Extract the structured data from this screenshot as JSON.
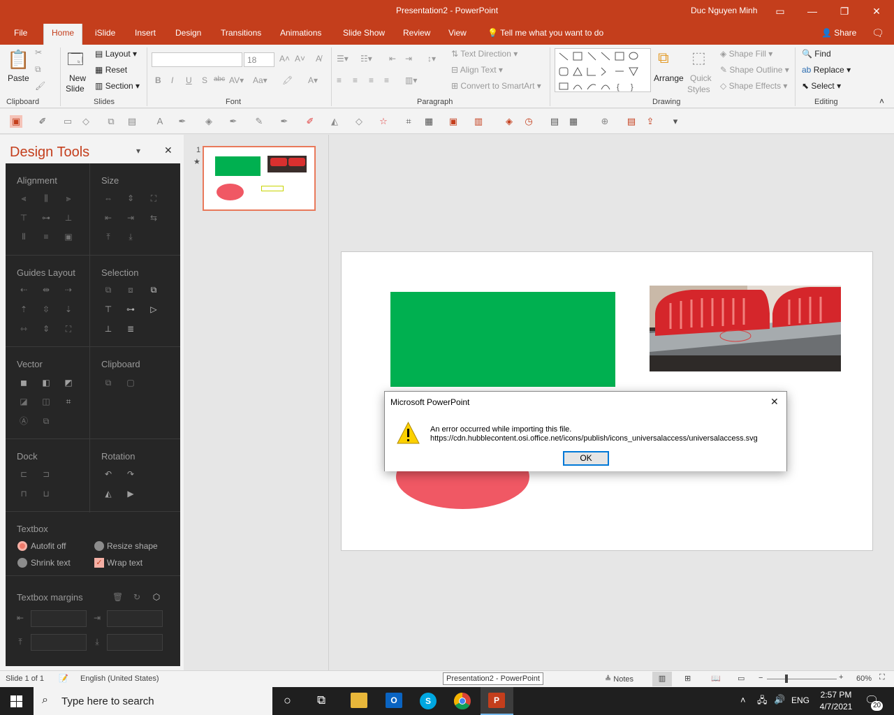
{
  "window": {
    "title": "Presentation2 - PowerPoint",
    "user": "Duc Nguyen Minh"
  },
  "tabs": [
    {
      "label": "File"
    },
    {
      "label": "Home"
    },
    {
      "label": "iSlide"
    },
    {
      "label": "Insert"
    },
    {
      "label": "Design"
    },
    {
      "label": "Transitions"
    },
    {
      "label": "Animations"
    },
    {
      "label": "Slide Show"
    },
    {
      "label": "Review"
    },
    {
      "label": "View"
    }
  ],
  "tell_me": "Tell me what you want to do",
  "share": "Share",
  "ribbon": {
    "clipboard": {
      "label": "Clipboard",
      "paste": "Paste"
    },
    "slides": {
      "label": "Slides",
      "new_slide": "New",
      "new_slide2": "Slide",
      "layout": "Layout",
      "reset": "Reset",
      "section": "Section"
    },
    "font": {
      "label": "Font",
      "font_name": "",
      "font_size": "18"
    },
    "paragraph": {
      "label": "Paragraph",
      "text_direction": "Text Direction",
      "align_text": "Align Text",
      "convert_smartart": "Convert to SmartArt"
    },
    "drawing": {
      "label": "Drawing",
      "arrange": "Arrange",
      "quick_styles": "Quick",
      "quick_styles2": "Styles",
      "shape_fill": "Shape Fill",
      "shape_outline": "Shape Outline",
      "shape_effects": "Shape Effects"
    },
    "editing": {
      "label": "Editing",
      "find": "Find",
      "replace": "Replace",
      "select": "Select"
    }
  },
  "design_tools": {
    "title": "Design Tools",
    "sections": {
      "alignment": "Alignment",
      "size": "Size",
      "guides_layout": "Guides Layout",
      "selection": "Selection",
      "vector": "Vector",
      "clipboard": "Clipboard",
      "dock": "Dock",
      "rotation": "Rotation",
      "textbox": "Textbox",
      "textbox_margins": "Textbox margins"
    },
    "textbox_options": {
      "autofit_off": "Autofit off",
      "resize_shape": "Resize shape",
      "shrink_text": "Shrink text",
      "wrap_text": "Wrap text"
    }
  },
  "thumbnail": {
    "number": "1",
    "star": "★"
  },
  "dialog": {
    "title": "Microsoft PowerPoint",
    "message": "An error occurred while importing this file.",
    "url": "https://cdn.hubblecontent.osi.office.net/icons/publish/icons_universalaccess/universalaccess.svg",
    "ok": "OK",
    "close": "✕"
  },
  "status": {
    "slide_count": "Slide 1 of 1",
    "language": "English (United States)",
    "tooltip": "Presentation2 - PowerPoint",
    "notes": "Notes",
    "zoom": "60%"
  },
  "taskbar": {
    "search_placeholder": "Type here to search",
    "language": "ENG",
    "time": "2:57 PM",
    "date": "4/7/2021",
    "notifications": "20"
  },
  "colors": {
    "brand": "#c43e1c",
    "green_shape": "#00b050",
    "oval": "#f05864"
  }
}
